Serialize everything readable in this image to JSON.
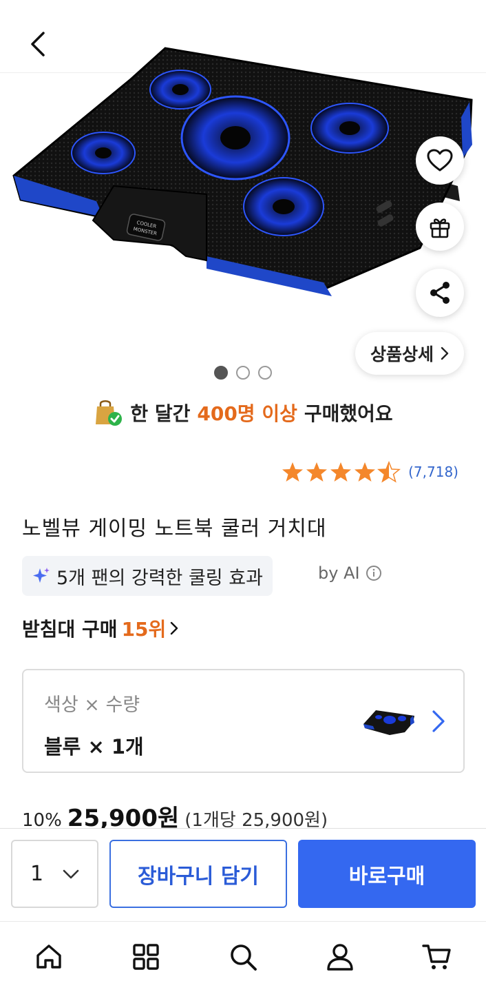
{
  "header": {
    "back_icon": "back-arrow-icon"
  },
  "gallery": {
    "image": "laptop-cooling-pad-image",
    "image_text": "COOLER MONSTER",
    "total_images": 3,
    "active_index": 0,
    "detail_label": "상품상세"
  },
  "floating_actions": [
    "heart-icon",
    "gift-icon",
    "share-icon"
  ],
  "purchase_banner": {
    "prefix": "한 달간",
    "highlight": "400명 이상",
    "suffix": "구매했어요",
    "colors": {
      "highlight": "#e46a1c"
    }
  },
  "rating": {
    "stars": 4.5,
    "count": "(7,718)"
  },
  "product": {
    "title": "노벨뷰 게이밍 노트북 쿨러 거치대",
    "ai_summary": "5개 팬의 강력한 쿨링 효과",
    "ai_label": "by AI",
    "rank_prefix": "받침대 구매",
    "rank_number": "15위"
  },
  "option": {
    "label": "색상 × 수량",
    "value": "블루 × 1개"
  },
  "price": {
    "discount": "10%",
    "amount": "25,900원",
    "unit_price": "(1개당 25,900원)"
  },
  "actions": {
    "quantity": "1",
    "cart_label": "장바구니 담기",
    "buy_label": "바로구매",
    "colors": {
      "primary": "#3468f0"
    }
  },
  "bottom_nav": [
    "home-icon",
    "grid-icon",
    "search-icon",
    "user-icon",
    "cart-icon"
  ]
}
